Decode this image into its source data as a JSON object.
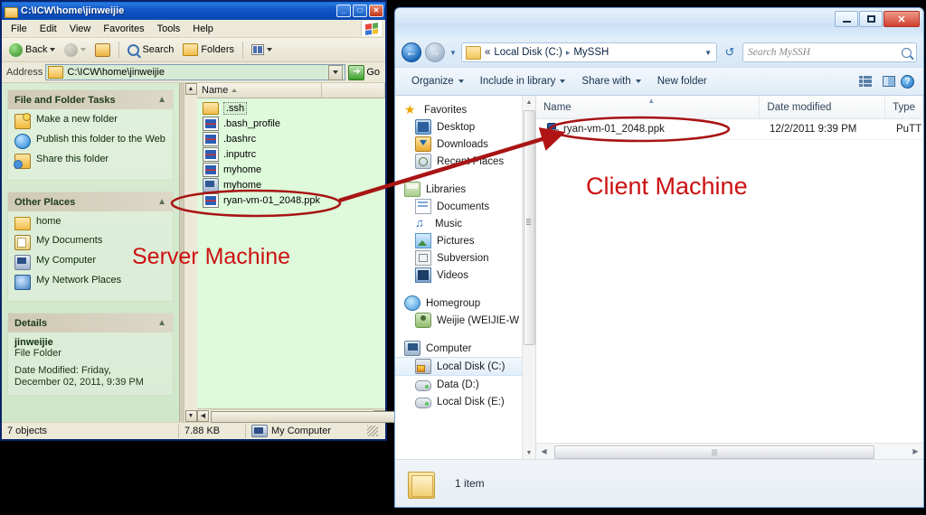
{
  "server_window": {
    "title": "C:\\ICW\\home\\jinweijie",
    "title_icon": "folder-icon",
    "window_buttons": [
      "minimize",
      "maximize",
      "close"
    ],
    "menu": [
      "File",
      "Edit",
      "View",
      "Favorites",
      "Tools",
      "Help"
    ],
    "toolbar": {
      "back": "Back",
      "forward": "",
      "up": "",
      "search": "Search",
      "folders": "Folders",
      "views": ""
    },
    "address": {
      "label": "Address",
      "value": "C:\\ICW\\home\\jinweijie",
      "go": "Go"
    },
    "panels": [
      {
        "title": "File and Folder Tasks",
        "items": [
          {
            "label": "Make a new folder",
            "icon": "new-folder-icon"
          },
          {
            "label": "Publish this folder to the Web",
            "icon": "globe-icon"
          },
          {
            "label": "Share this folder",
            "icon": "share-folder-icon"
          }
        ]
      },
      {
        "title": "Other Places",
        "items": [
          {
            "label": "home",
            "icon": "folder-icon"
          },
          {
            "label": "My Documents",
            "icon": "my-documents-icon"
          },
          {
            "label": "My Computer",
            "icon": "my-computer-icon"
          },
          {
            "label": "My Network Places",
            "icon": "network-places-icon"
          }
        ]
      }
    ],
    "details": {
      "title": "Details",
      "name": "jinweijie",
      "type": "File Folder",
      "date_line1": "Date Modified: Friday,",
      "date_line2": "December 02, 2011, 9:39 PM"
    },
    "column_header": "Name",
    "files": [
      {
        "name": ".ssh",
        "icon": "folder-icon",
        "selected": true
      },
      {
        "name": ".bash_profile",
        "icon": "file-icon",
        "selected": false
      },
      {
        "name": ".bashrc",
        "icon": "file-icon",
        "selected": false
      },
      {
        "name": ".inputrc",
        "icon": "file-icon",
        "selected": false
      },
      {
        "name": "myhome",
        "icon": "file-icon",
        "selected": false
      },
      {
        "name": "myhome",
        "icon": "computer-file-icon",
        "selected": false
      },
      {
        "name": "ryan-vm-01_2048.ppk",
        "icon": "file-icon",
        "selected": false
      }
    ],
    "status": {
      "objects": "7 objects",
      "size": "7.88 KB",
      "location": "My Computer"
    }
  },
  "client_window": {
    "window_buttons": [
      "minimize",
      "maximize",
      "close"
    ],
    "close_glyph": "✕",
    "breadcrumb": {
      "prefix": "«",
      "parts": [
        "Local Disk (C:)",
        "MySSH"
      ],
      "separator": "▸"
    },
    "search": {
      "placeholder": "Search MySSH"
    },
    "command_bar": {
      "organize": "Organize",
      "include_in_library": "Include in library",
      "share_with": "Share with",
      "new_folder": "New folder"
    },
    "nav": {
      "groups": [
        {
          "header": {
            "label": "Favorites",
            "icon": "star-icon"
          },
          "items": [
            {
              "label": "Desktop",
              "icon": "desktop-icon"
            },
            {
              "label": "Downloads",
              "icon": "downloads-icon"
            },
            {
              "label": "Recent Places",
              "icon": "recent-places-icon"
            }
          ]
        },
        {
          "header": {
            "label": "Libraries",
            "icon": "libraries-icon"
          },
          "items": [
            {
              "label": "Documents",
              "icon": "documents-icon"
            },
            {
              "label": "Music",
              "icon": "music-icon"
            },
            {
              "label": "Pictures",
              "icon": "pictures-icon"
            },
            {
              "label": "Subversion",
              "icon": "subversion-icon"
            },
            {
              "label": "Videos",
              "icon": "videos-icon"
            }
          ]
        },
        {
          "header": {
            "label": "Homegroup",
            "icon": "homegroup-icon"
          },
          "items": [
            {
              "label": "Weijie (WEIJIE-W",
              "icon": "user-icon"
            }
          ]
        },
        {
          "header": {
            "label": "Computer",
            "icon": "computer-icon"
          },
          "items": [
            {
              "label": "Local Disk (C:)",
              "icon": "local-disk-icon",
              "selected": true
            },
            {
              "label": "Data (D:)",
              "icon": "drive-icon"
            },
            {
              "label": "Local Disk (E:)",
              "icon": "drive-icon"
            }
          ]
        }
      ]
    },
    "columns": [
      "Name",
      "Date modified",
      "Type"
    ],
    "rows": [
      {
        "name": "ryan-vm-01_2048.ppk",
        "date_modified": "12/2/2011 9:39 PM",
        "type": "PuTT",
        "icon": "ppk-file-icon"
      }
    ],
    "status": {
      "item_count": "1 item",
      "icon": "folder-icon"
    }
  },
  "annotations": {
    "server_label": "Server Machine",
    "client_label": "Client Machine",
    "accent_color": "#cc1111",
    "arrow": "red-arrow-transfer",
    "ellipse_server": "highlight-ellipse-server-file",
    "ellipse_client": "highlight-ellipse-client-file"
  }
}
